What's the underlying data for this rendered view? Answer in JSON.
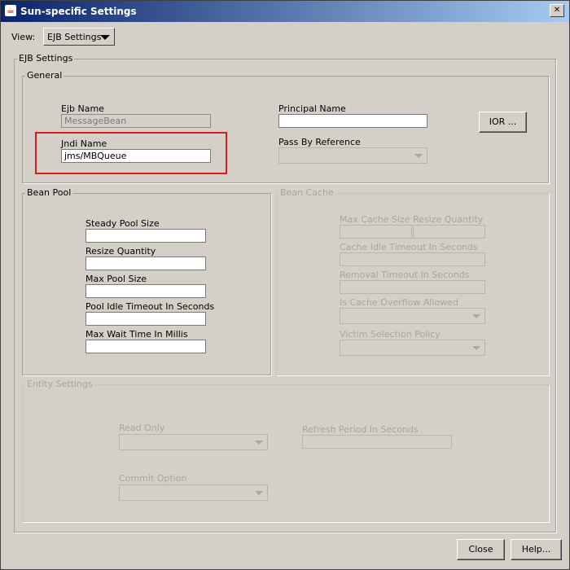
{
  "window": {
    "title": "Sun-specific Settings",
    "close_glyph": "✕",
    "app_icon": "java-cup-icon"
  },
  "view": {
    "label": "View:",
    "selected": "EJB Settings"
  },
  "ejb_settings": {
    "label": "EJB Settings"
  },
  "general": {
    "label": "General",
    "ejb_name_label": "Ejb Name",
    "ejb_name_value": "MessageBean",
    "jndi_name_label": "Jndi Name",
    "jndi_name_value": "jms/MBQueue",
    "principal_name_label": "Principal Name",
    "principal_name_value": "",
    "pass_by_reference_label": "Pass By Reference",
    "ior_button": "IOR ..."
  },
  "bean_pool": {
    "label": "Bean Pool",
    "steady_pool_size": "Steady Pool Size",
    "resize_quantity": "Resize Quantity",
    "max_pool_size": "Max Pool Size",
    "pool_idle_timeout": "Pool Idle Timeout In Seconds",
    "max_wait_time": "Max Wait Time In Millis"
  },
  "bean_cache": {
    "label": "Bean Cache",
    "max_cache_size": "Max Cache Size",
    "resize_quantity": "Resize Quantity",
    "cache_idle_timeout": "Cache Idle Timeout  In Seconds",
    "removal_timeout": "Removal Timeout In Seconds",
    "is_cache_overflow_allowed": "Is Cache Overflow Allowed",
    "victim_selection_policy": "Victim Selection Policy"
  },
  "entity_settings": {
    "label": "Entity Settings",
    "read_only": "Read Only",
    "refresh_period": "Refresh Period In Seconds",
    "commit_option": "Commit Option"
  },
  "buttons": {
    "close": "Close",
    "help": "Help..."
  }
}
